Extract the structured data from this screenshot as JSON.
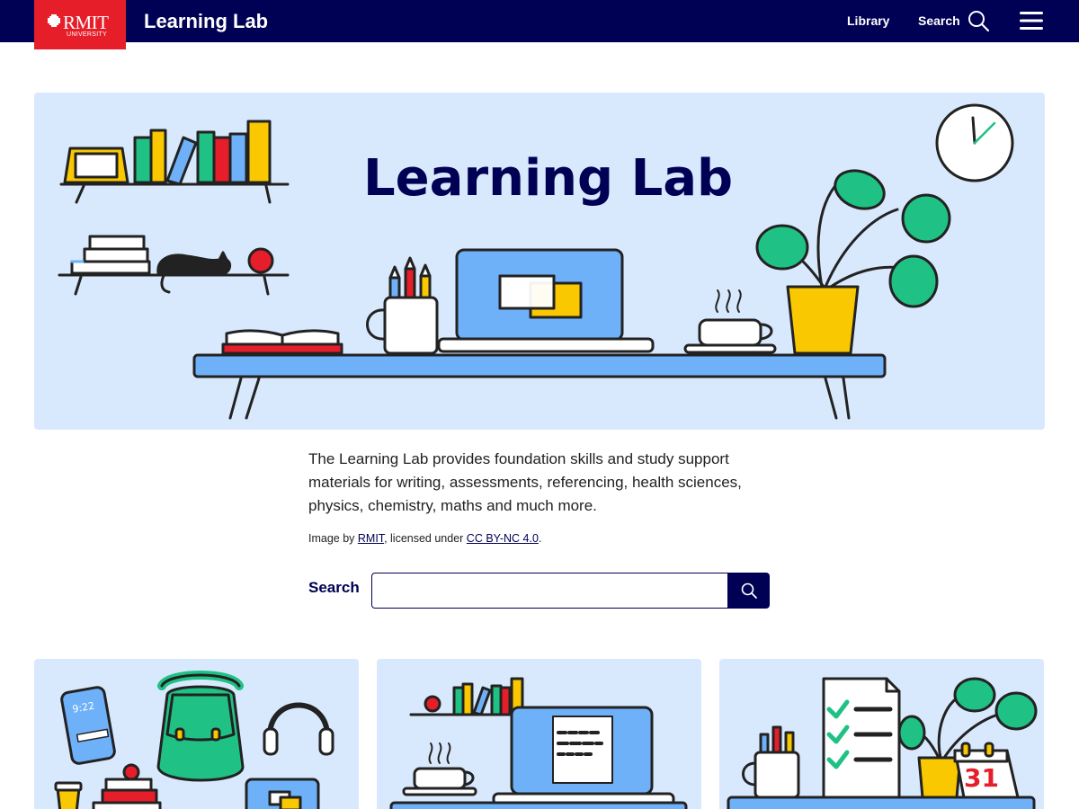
{
  "header": {
    "logo_text": "RMIT",
    "logo_subtext": "UNIVERSITY",
    "site_title": "Learning Lab",
    "nav_library": "Library",
    "nav_search": "Search"
  },
  "hero": {
    "title": "Learning Lab"
  },
  "intro": {
    "description": "The Learning Lab provides foundation skills and study support materials for writing, assessments, referencing, health sciences, physics, chemistry, maths and much more.",
    "credit_prefix": "Image by ",
    "credit_author": "RMIT",
    "credit_middle": ", licensed under ",
    "credit_license": "CC BY-NC 4.0",
    "credit_suffix": "."
  },
  "search": {
    "label": "Search",
    "value": ""
  },
  "cards": {
    "card1_phone_time": "9:22",
    "card3_calendar_day": "31"
  },
  "colors": {
    "navy": "#000054",
    "rmit_red": "#e61e2a",
    "hero_bg": "#d9e9fd",
    "blue": "#6fb1f9",
    "green": "#1fc184",
    "yellow": "#f9c800",
    "red": "#e61e2a"
  },
  "icons": {
    "search": "magnifier",
    "menu": "hamburger"
  }
}
